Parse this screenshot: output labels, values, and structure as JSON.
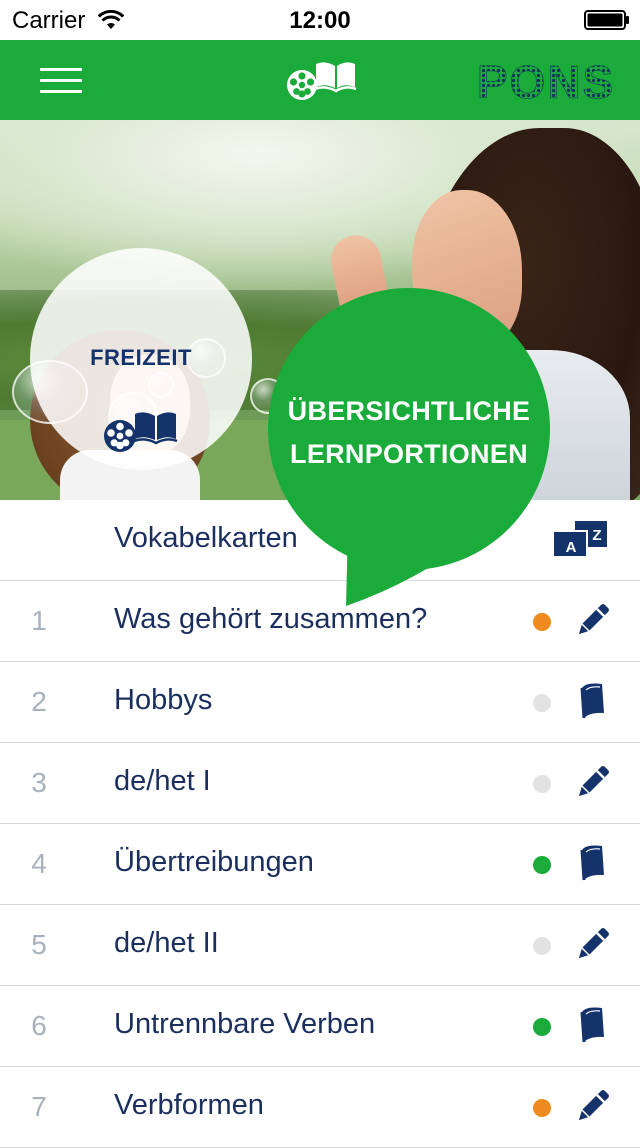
{
  "status_bar": {
    "carrier": "Carrier",
    "time": "12:00"
  },
  "nav": {
    "brand": "PONS",
    "menu_icon": "menu-icon",
    "home_icon": "film-book-icon"
  },
  "hero": {
    "category": "FREIZEIT",
    "category_icon": "film-book-icon",
    "bubble_line1": "ÜBERSICHTLICHE",
    "bubble_line2": "LERNPORTIONEN",
    "bubble_color": "#1aab3a"
  },
  "list": {
    "header_label": "Vokabelkarten",
    "header_icon": "az-cards-icon",
    "items": [
      {
        "number": "1",
        "title": "Was gehört zusammen?",
        "status": "orange",
        "icon": "pencil-icon"
      },
      {
        "number": "2",
        "title": "Hobbys",
        "status": "grey",
        "icon": "book-icon"
      },
      {
        "number": "3",
        "title": "de/het I",
        "status": "grey",
        "icon": "pencil-icon"
      },
      {
        "number": "4",
        "title": "Übertreibungen",
        "status": "green",
        "icon": "book-icon"
      },
      {
        "number": "5",
        "title": "de/het II",
        "status": "grey",
        "icon": "pencil-icon"
      },
      {
        "number": "6",
        "title": "Untrennbare Verben",
        "status": "green",
        "icon": "book-icon"
      },
      {
        "number": "7",
        "title": "Verbformen",
        "status": "orange",
        "icon": "pencil-icon"
      }
    ]
  },
  "colors": {
    "brand_green": "#1aab3a",
    "navy": "#15336b",
    "status_orange": "#ef8a1e",
    "status_green": "#1aab3a",
    "status_grey": "#e2e2e2"
  }
}
